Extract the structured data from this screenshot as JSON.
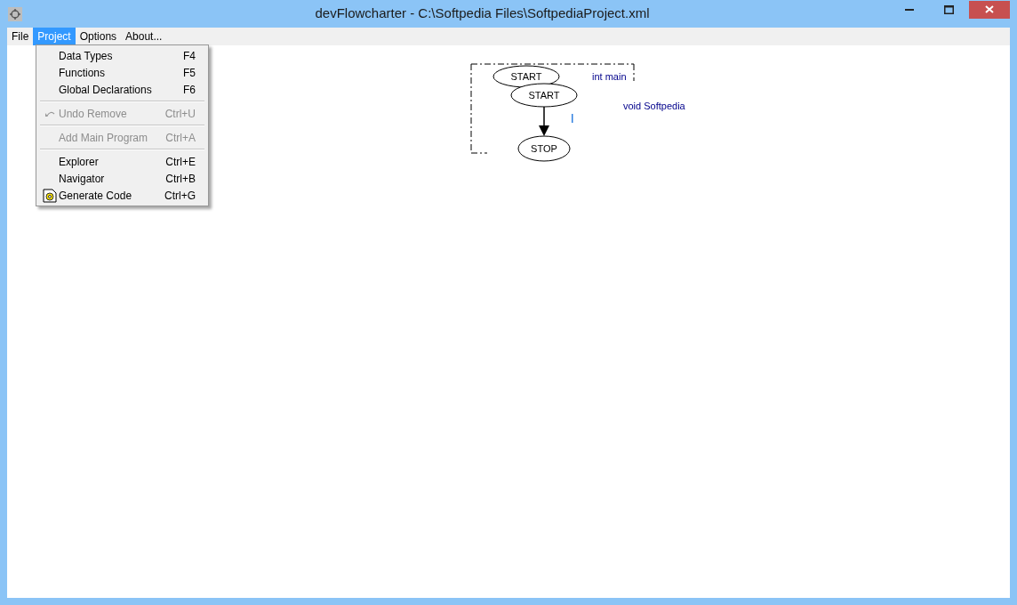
{
  "window": {
    "title": "devFlowcharter - C:\\Softpedia Files\\SoftpediaProject.xml"
  },
  "menu_bar": [
    {
      "label": "File",
      "selected": false
    },
    {
      "label": "Project",
      "selected": true
    },
    {
      "label": "Options",
      "selected": false
    },
    {
      "label": "About...",
      "selected": false
    }
  ],
  "dropdown": [
    {
      "kind": "plain",
      "label": "Data Types",
      "shortcut": "F4",
      "disabled": false
    },
    {
      "kind": "plain",
      "label": "Functions",
      "shortcut": "F5",
      "disabled": false
    },
    {
      "kind": "plain",
      "label": "Global Declarations",
      "shortcut": "F6",
      "disabled": false
    },
    {
      "kind": "separator"
    },
    {
      "kind": "undo",
      "label": "Undo Remove",
      "shortcut": "Ctrl+U",
      "disabled": true
    },
    {
      "kind": "separator"
    },
    {
      "kind": "plain",
      "label": "Add Main Program",
      "shortcut": "Ctrl+A",
      "disabled": true
    },
    {
      "kind": "separator"
    },
    {
      "kind": "plain",
      "label": "Explorer",
      "shortcut": "Ctrl+E",
      "disabled": false
    },
    {
      "kind": "plain",
      "label": "Navigator",
      "shortcut": "Ctrl+B",
      "disabled": false
    },
    {
      "kind": "generate",
      "label": "Generate Code",
      "shortcut": "Ctrl+G",
      "disabled": false
    }
  ],
  "diagram": {
    "nodes": [
      {
        "label": "START"
      },
      {
        "label": "START"
      },
      {
        "label": "STOP"
      }
    ],
    "labels": [
      {
        "text": "int main"
      },
      {
        "text": "void Softpedia"
      }
    ]
  }
}
